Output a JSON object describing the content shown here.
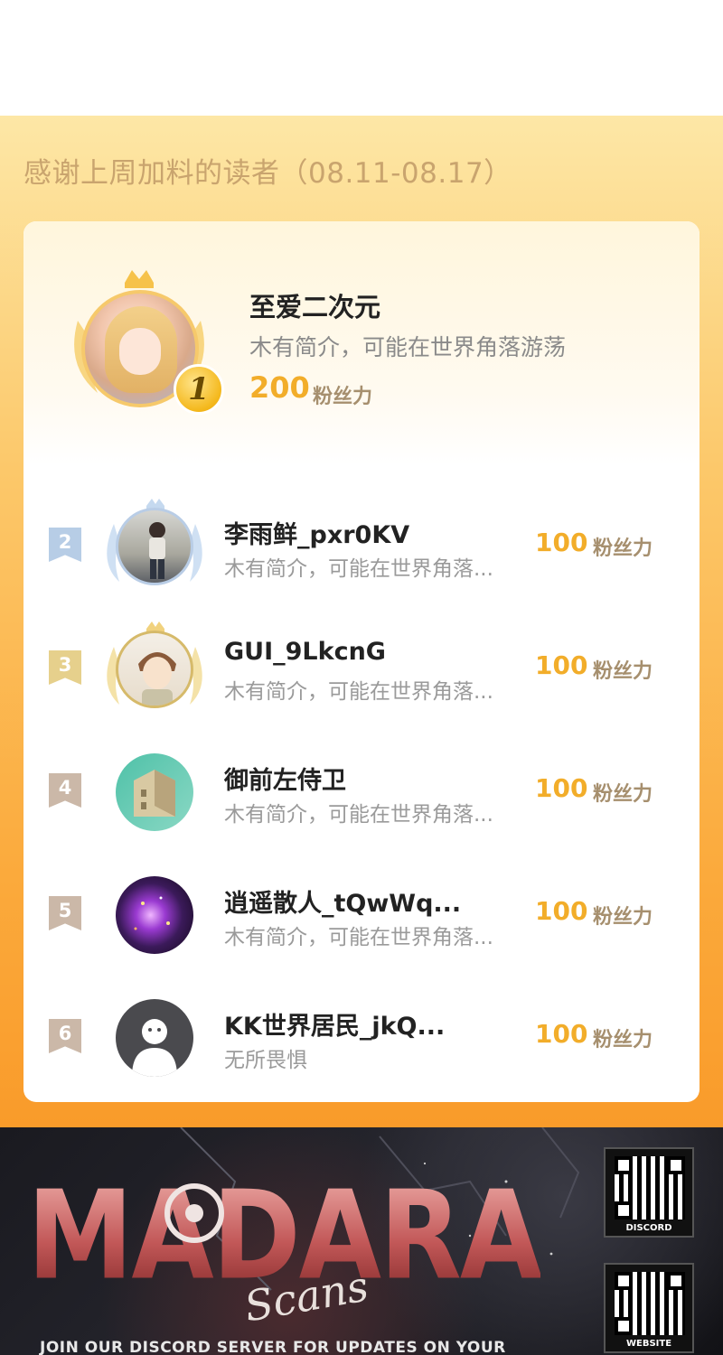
{
  "section": {
    "title": "感谢上周加料的读者（08.11-08.17）"
  },
  "top_reader": {
    "rank": "1",
    "name": "至爱二次元",
    "bio": "木有简介，可能在世界角落游荡",
    "score": "200",
    "unit": "粉丝力"
  },
  "readers": [
    {
      "rank": "2",
      "name": "李雨鲜_pxr0KV",
      "bio": "木有简介，可能在世界角落...",
      "score": "100",
      "unit": "粉丝力",
      "rank_color": "#a9c3e2"
    },
    {
      "rank": "3",
      "name": "GUI_9LkcnG",
      "bio": "木有简介，可能在世界角落...",
      "score": "100",
      "unit": "粉丝力",
      "rank_color": "#e5cf8e"
    },
    {
      "rank": "4",
      "name": "御前左侍卫",
      "bio": "木有简介，可能在世界角落...",
      "score": "100",
      "unit": "粉丝力",
      "rank_color": "#cbb8a8"
    },
    {
      "rank": "5",
      "name": "逍遥散人_tQwWq...",
      "bio": "木有简介，可能在世界角落...",
      "score": "100",
      "unit": "粉丝力",
      "rank_color": "#cbb8a8"
    },
    {
      "rank": "6",
      "name": "KK世界居民_jkQ...",
      "bio": "无所畏惧",
      "score": "100",
      "unit": "粉丝力",
      "rank_color": "#cbb8a8"
    }
  ],
  "banner": {
    "logo_text": "MADARA",
    "logo_sub": "Scans",
    "slogan": "JOIN OUR DISCORD SERVER FOR UPDATES ON YOUR",
    "qr_discord_label": "DISCORD",
    "qr_website_label": "WEBSITE"
  },
  "colors": {
    "accent_gold": "#f2ad2a",
    "panel_top": "#fde7a6",
    "panel_bottom": "#f99b2a"
  }
}
